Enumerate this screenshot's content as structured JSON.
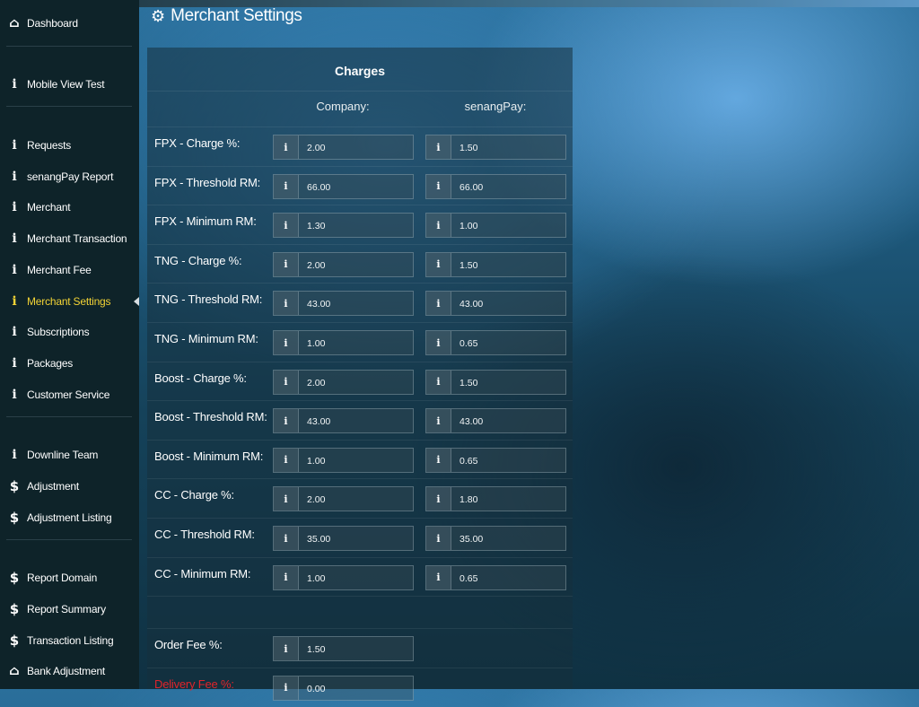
{
  "header": {
    "title": "Merchant Settings",
    "icon": "gear-icon"
  },
  "sidebar": {
    "items": [
      {
        "label": "Dashboard",
        "icon": "home-icon"
      },
      {
        "label": "Mobile View Test",
        "icon": "info-icon"
      },
      {
        "label": "Requests",
        "icon": "info-icon"
      },
      {
        "label": "senangPay Report",
        "icon": "info-icon"
      },
      {
        "label": "Merchant",
        "icon": "info-icon"
      },
      {
        "label": "Merchant Transaction",
        "icon": "info-icon"
      },
      {
        "label": "Merchant Fee",
        "icon": "info-icon"
      },
      {
        "label": "Merchant Settings",
        "icon": "info-icon",
        "active": true
      },
      {
        "label": "Subscriptions",
        "icon": "info-icon"
      },
      {
        "label": "Packages",
        "icon": "info-icon"
      },
      {
        "label": "Customer Service",
        "icon": "info-icon"
      },
      {
        "label": "Downline Team",
        "icon": "info-icon"
      },
      {
        "label": "Adjustment",
        "icon": "dollar-icon"
      },
      {
        "label": "Adjustment Listing",
        "icon": "dollar-icon"
      },
      {
        "label": "Report Domain",
        "icon": "dollar-icon"
      },
      {
        "label": "Report Summary",
        "icon": "dollar-icon"
      },
      {
        "label": "Transaction Listing",
        "icon": "dollar-icon"
      },
      {
        "label": "Bank Adjustment",
        "icon": "bank-icon"
      }
    ]
  },
  "charges": {
    "title": "Charges",
    "col_company": "Company:",
    "col_senangpay": "senangPay:",
    "rows": [
      {
        "label": "FPX - Charge %:",
        "company": "2.00",
        "senangpay": "1.50"
      },
      {
        "label": "FPX - Threshold RM:",
        "company": "66.00",
        "senangpay": "66.00"
      },
      {
        "label": "FPX - Minimum RM:",
        "company": "1.30",
        "senangpay": "1.00"
      },
      {
        "label": "TNG - Charge %:",
        "company": "2.00",
        "senangpay": "1.50"
      },
      {
        "label": "TNG - Threshold RM:",
        "company": "43.00",
        "senangpay": "43.00"
      },
      {
        "label": "TNG - Minimum RM:",
        "company": "1.00",
        "senangpay": "0.65"
      },
      {
        "label": "Boost - Charge %:",
        "company": "2.00",
        "senangpay": "1.50"
      },
      {
        "label": "Boost - Threshold RM:",
        "company": "43.00",
        "senangpay": "43.00"
      },
      {
        "label": "Boost - Minimum RM:",
        "company": "1.00",
        "senangpay": "0.65"
      },
      {
        "label": "CC - Charge %:",
        "company": "2.00",
        "senangpay": "1.80"
      },
      {
        "label": "CC - Threshold RM:",
        "company": "35.00",
        "senangpay": "35.00"
      },
      {
        "label": "CC - Minimum RM:",
        "company": "1.00",
        "senangpay": "0.65"
      }
    ],
    "fees": [
      {
        "label": "Order Fee %:",
        "value": "1.50",
        "color": "#ffffff"
      },
      {
        "label": "Delivery Fee %:",
        "value": "0.00",
        "color": "#e0242b"
      }
    ]
  },
  "colors": {
    "active": "#f2d335",
    "delivery_label": "#e0242b",
    "sidebar_bg": "#0e2329"
  }
}
